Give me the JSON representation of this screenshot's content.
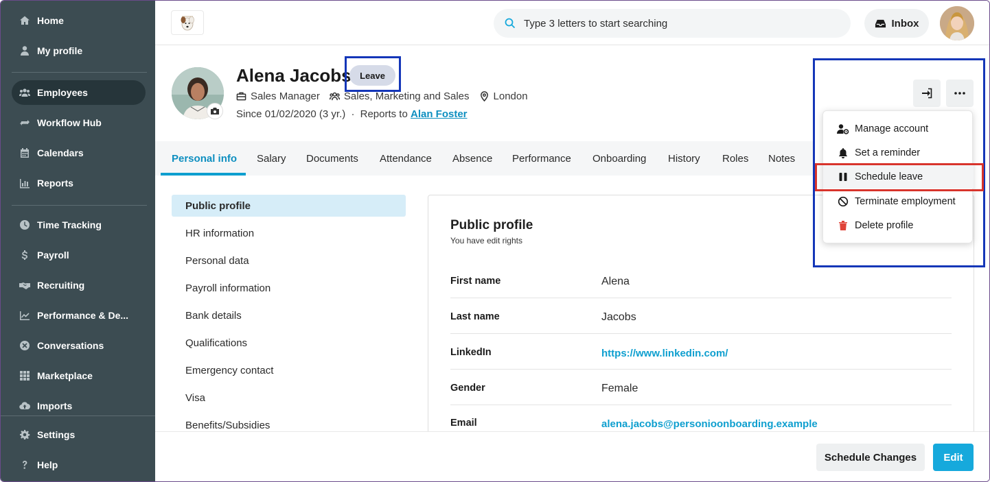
{
  "sidebar": {
    "items": [
      {
        "label": "Home",
        "icon": "home-icon"
      },
      {
        "label": "My profile",
        "icon": "person-icon"
      },
      {
        "label": "Employees",
        "icon": "people-icon",
        "active": true
      },
      {
        "label": "Workflow Hub",
        "icon": "repeat-icon"
      },
      {
        "label": "Calendars",
        "icon": "calendar-icon"
      },
      {
        "label": "Reports",
        "icon": "bar-chart-icon"
      },
      {
        "label": "Time Tracking",
        "icon": "clock-icon"
      },
      {
        "label": "Payroll",
        "icon": "dollar-icon"
      },
      {
        "label": "Recruiting",
        "icon": "handshake-icon"
      },
      {
        "label": "Performance & De...",
        "icon": "trend-icon"
      },
      {
        "label": "Conversations",
        "icon": "chat-icon"
      },
      {
        "label": "Marketplace",
        "icon": "grid-icon"
      },
      {
        "label": "Imports",
        "icon": "cloud-upload-icon"
      },
      {
        "label": "Settings",
        "icon": "gear-icon"
      },
      {
        "label": "Help",
        "icon": "question-icon"
      }
    ]
  },
  "topbar": {
    "search_placeholder": "Type 3 letters to start searching",
    "inbox_label": "Inbox"
  },
  "profile": {
    "name": "Alena Jacobs",
    "status_badge": "Leave",
    "position": "Sales Manager",
    "department": "Sales, Marketing and Sales",
    "office": "London",
    "since": "Since 01/02/2020 (3 yr.)",
    "separator": "·",
    "reports_to_label": "Reports to",
    "reports_to_name": "Alan Foster"
  },
  "tabs": [
    "Personal info",
    "Salary",
    "Documents",
    "Attendance",
    "Absence",
    "Performance",
    "Onboarding",
    "History",
    "Roles",
    "Notes"
  ],
  "subnav": [
    "Public profile",
    "HR information",
    "Personal data",
    "Payroll information",
    "Bank details",
    "Qualifications",
    "Emergency contact",
    "Visa",
    "Benefits/Subsidies"
  ],
  "card": {
    "title": "Public profile",
    "subtitle": "You have edit rights",
    "fields": [
      {
        "label": "First name",
        "value": "Alena"
      },
      {
        "label": "Last name",
        "value": "Jacobs"
      },
      {
        "label": "LinkedIn",
        "value": "https://www.linkedin.com/"
      },
      {
        "label": "Gender",
        "value": "Female"
      },
      {
        "label": "Email",
        "value": "alena.jacobs@personioonboarding.example"
      }
    ]
  },
  "dropdown": {
    "items": [
      {
        "label": "Manage account",
        "icon": "user-gear-icon"
      },
      {
        "label": "Set a reminder",
        "icon": "bell-icon"
      },
      {
        "label": "Schedule leave",
        "icon": "pause-icon"
      },
      {
        "label": "Terminate employment",
        "icon": "ban-icon"
      },
      {
        "label": "Delete profile",
        "icon": "trash-icon"
      }
    ]
  },
  "footer": {
    "schedule_label": "Schedule Changes",
    "edit_label": "Edit"
  },
  "colors": {
    "sidebar_bg": "#3c4c52",
    "accent": "#16a9dc",
    "highlight_blue": "#1436b8",
    "highlight_red": "#d8342c",
    "delete_red": "#e0443a"
  }
}
